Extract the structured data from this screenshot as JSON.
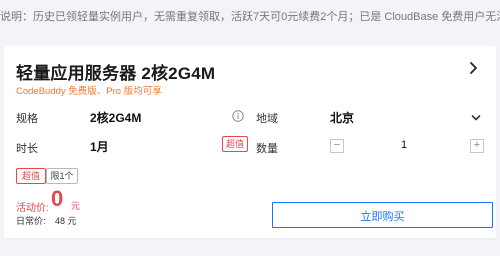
{
  "notice": "说明：历史已领轻量实例用户，无需重复领取，活跃7天可0元续费2个月；已是 CloudBase 免费用户无法再次领取",
  "product": {
    "title": "轻量应用服务器 2核2G4M",
    "subtitle": "CodeBuddy 免费版、Pro 版均可享"
  },
  "fields": {
    "spec_label": "规格",
    "spec_value": "2核2G4M",
    "region_label": "地域",
    "region_value": "北京",
    "duration_label": "时长",
    "duration_value": "1月",
    "duration_badge": "超值",
    "quantity_label": "数量",
    "quantity_value": "1"
  },
  "tags": [
    "超值",
    "限1个"
  ],
  "pricing": {
    "promo_label": "活动价:",
    "promo_value": "0",
    "promo_unit": "元",
    "daily_label": "日常价:",
    "daily_value": "48 元"
  },
  "actions": {
    "buy_label": "立即购买"
  },
  "icons": {
    "chevron_right": "chevron-right-icon",
    "info": "info-icon",
    "dropdown": "chevron-down-icon",
    "minus": "minus-icon",
    "plus": "plus-icon"
  },
  "colors": {
    "accent_blue": "#1677ff",
    "accent_red": "#e5484d",
    "subtitle_orange": "#ef7a2c"
  }
}
